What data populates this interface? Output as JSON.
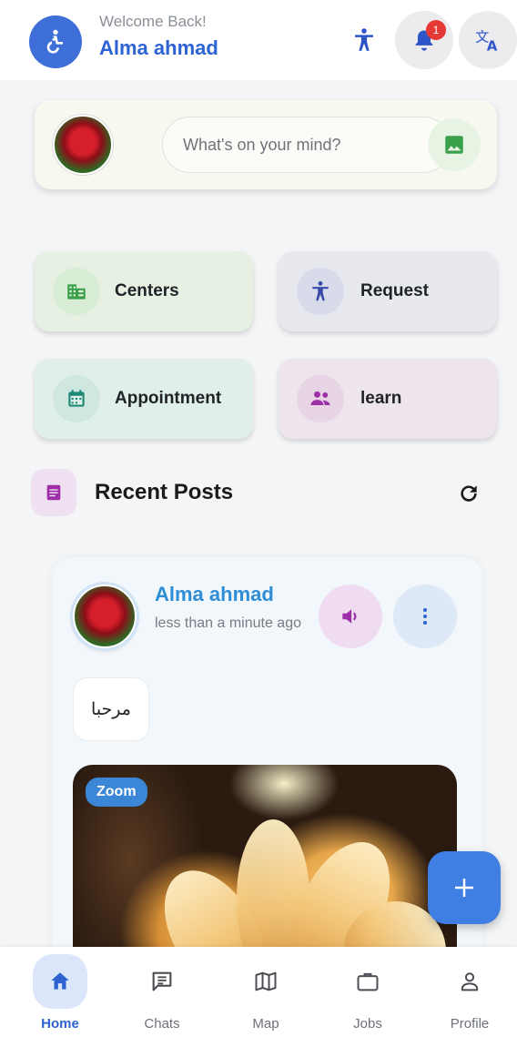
{
  "header": {
    "welcome": "Welcome Back!",
    "username": "Alma ahmad",
    "notification_count": "1",
    "icons": [
      "accessibility-icon",
      "accessibility-person-icon",
      "bell-icon",
      "translate-icon"
    ]
  },
  "composer": {
    "placeholder": "What's on your mind?",
    "icons": [
      "avatar",
      "image-icon"
    ]
  },
  "tiles": [
    {
      "label": "Centers",
      "icon": "building-icon",
      "color": "#3aa04a"
    },
    {
      "label": "Request",
      "icon": "accessibility-person-icon",
      "color": "#3b49a8"
    },
    {
      "label": "Appointment",
      "icon": "calendar-icon",
      "color": "#1f8a76"
    },
    {
      "label": "learn",
      "icon": "group-icon",
      "color": "#9c2fa8"
    }
  ],
  "recent_posts": {
    "title": "Recent Posts",
    "icons": [
      "article-icon",
      "refresh-icon"
    ]
  },
  "post": {
    "author": "Alma ahmad",
    "time": "less than a minute ago",
    "text": "مرحبا",
    "image_chip": "Zoom",
    "icons": [
      "speaker-icon",
      "more-vertical-icon"
    ]
  },
  "bottom_nav": [
    {
      "label": "Home",
      "icon": "home-icon",
      "active": true
    },
    {
      "label": "Chats",
      "icon": "chat-icon",
      "active": false
    },
    {
      "label": "Map",
      "icon": "map-icon",
      "active": false
    },
    {
      "label": "Jobs",
      "icon": "briefcase-icon",
      "active": false
    },
    {
      "label": "Profile",
      "icon": "person-icon",
      "active": false
    }
  ],
  "colors": {
    "primary": "#2d63d2",
    "badge": "#e53935",
    "author": "#2f8dd6"
  }
}
